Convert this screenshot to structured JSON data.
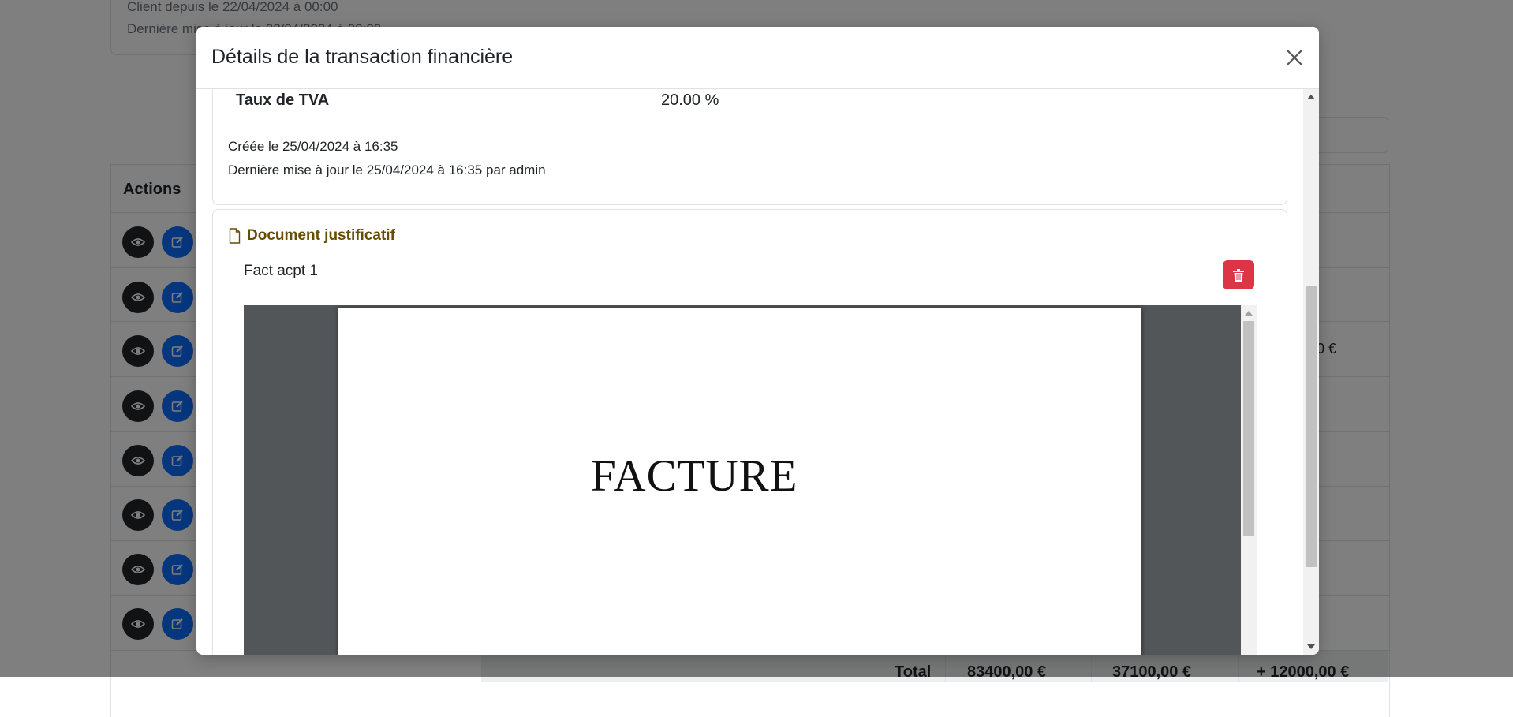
{
  "background": {
    "client_since": "Client depuis le 22/04/2024 à 00:00",
    "client_updated": "Dernière mise à jour le 22/04/2024 à 00:00",
    "table_header_actions": "Actions",
    "visible_amount": "0 €",
    "totals": {
      "label": "Total",
      "col1": "83400,00 €",
      "col2": "37100,00 €",
      "col3": "+ 12000,00 €"
    }
  },
  "modal": {
    "title": "Détails de la transaction financière",
    "close_icon": "close-icon",
    "info": {
      "label": "Taux de TVA",
      "value": "20.00 %",
      "created": "Créée le 25/04/2024 à 16:35",
      "updated": "Dernière mise à jour le 25/04/2024 à 16:35 par admin"
    },
    "document": {
      "section_title": "Document justificatif",
      "section_icon": "file-icon",
      "file_name": "Fact acpt 1",
      "delete_icon": "trash-icon",
      "pdf_heading": "FACTURE"
    }
  },
  "colors": {
    "danger": "#dc3545",
    "primary": "#0d6efd",
    "dark": "#212529",
    "doc_title": "#664d03"
  }
}
